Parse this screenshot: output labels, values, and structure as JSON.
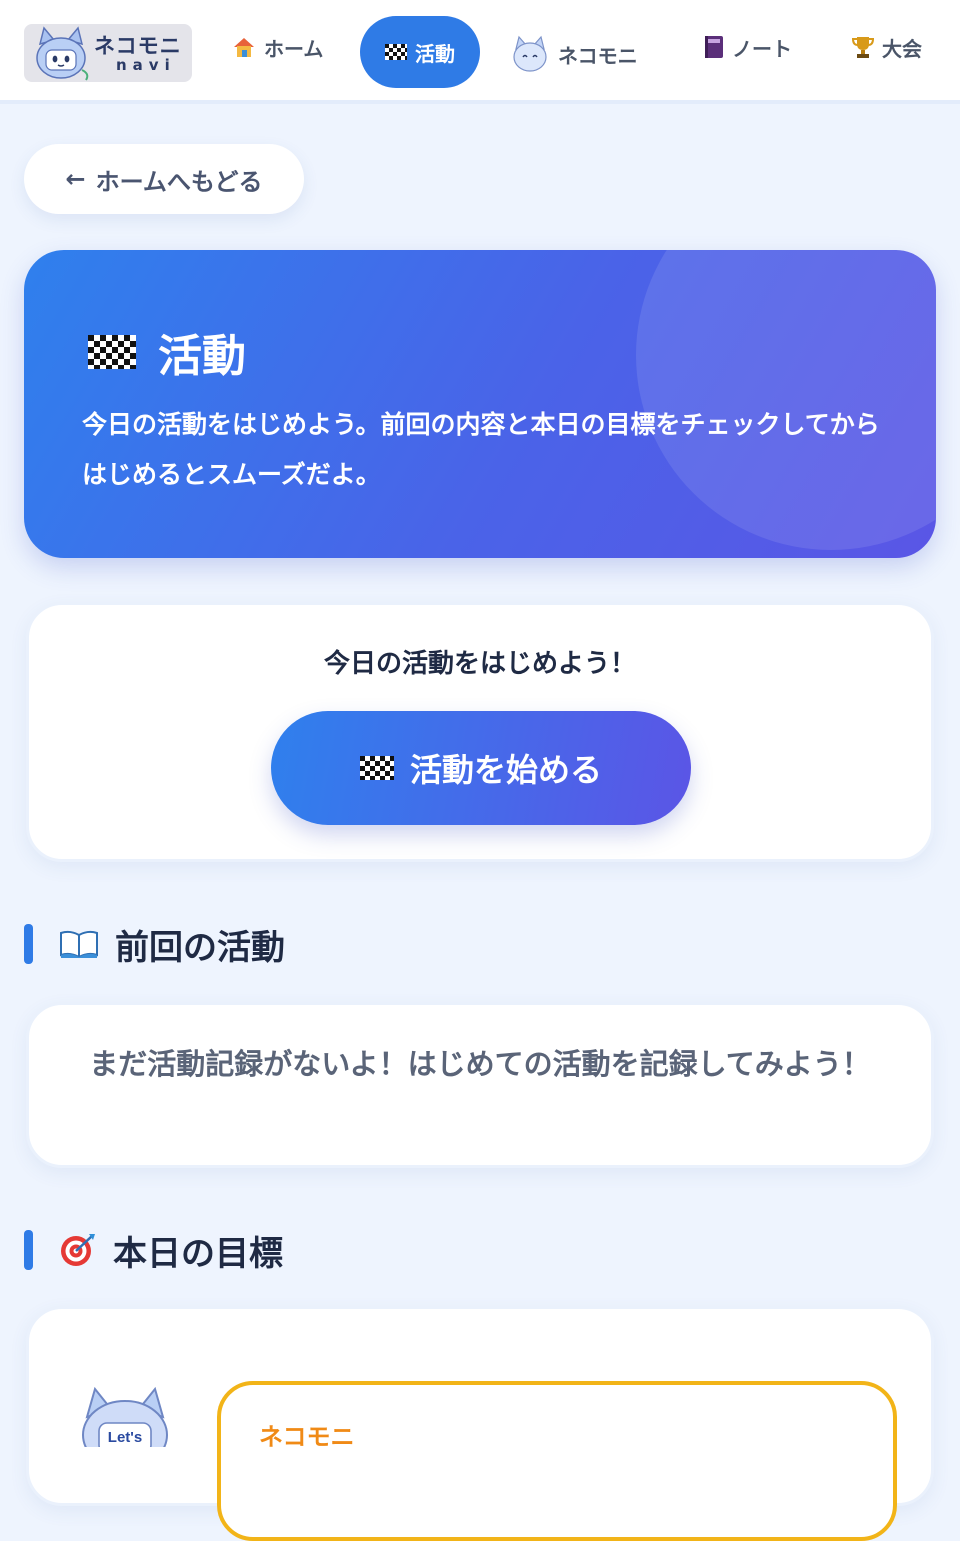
{
  "nav": {
    "logo_title": "ネコモニ",
    "logo_subtitle": "navi",
    "items": [
      {
        "label": "ホーム",
        "icon": "house-icon"
      },
      {
        "label": "活動",
        "icon": "checkered-flag-icon",
        "active": true
      },
      {
        "label": "ネコモニ",
        "icon": "cat-icon"
      },
      {
        "label": "ノート",
        "icon": "notebook-icon"
      },
      {
        "label": "大会",
        "icon": "trophy-icon"
      }
    ]
  },
  "back_button": {
    "arrow": "←",
    "label": "ホームへもどる"
  },
  "hero": {
    "title": "活動",
    "description": "今日の活動をはじめよう。前回の内容と本日の目標をチェックしてからはじめるとスムーズだよ。"
  },
  "start": {
    "prompt": "今日の活動をはじめよう！",
    "button_label": "活動を始める"
  },
  "previous": {
    "heading": "前回の活動",
    "icon": "open-book-icon",
    "empty_message": "まだ活動記録がないよ！はじめての活動を記録してみよう！"
  },
  "goal": {
    "heading": "本日の目標",
    "icon": "target-icon",
    "mascot_badge": "Let's",
    "speaker": "ネコモニ"
  },
  "colors": {
    "accent": "#2f7be6",
    "gradient_start": "#2f80ed",
    "gradient_end": "#5b55e6",
    "speech_border": "#f2b418",
    "speaker_name": "#f08a16",
    "page_bg": "#eef4fe"
  }
}
